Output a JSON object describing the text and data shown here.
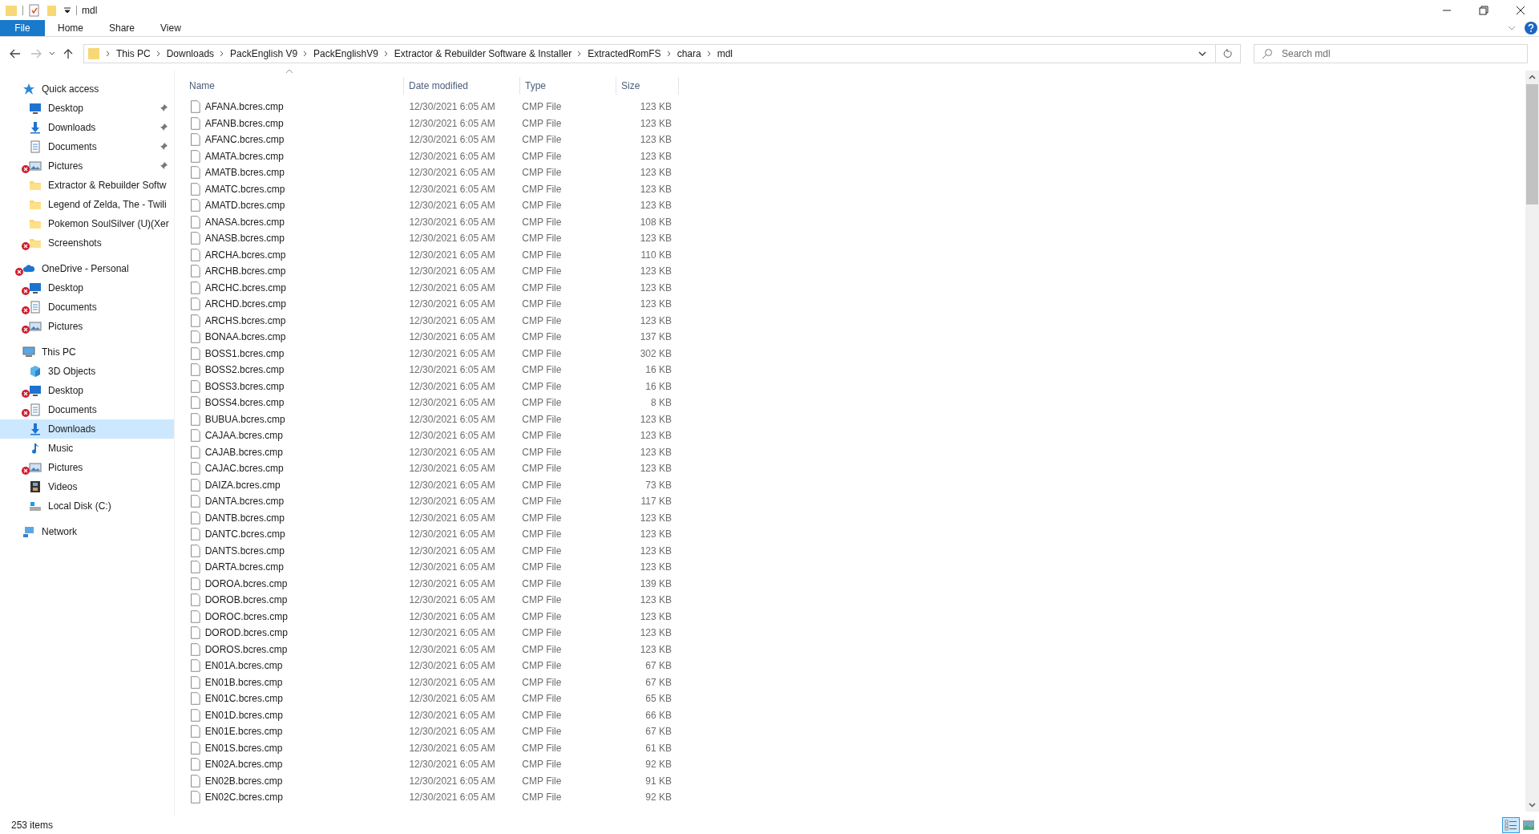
{
  "window": {
    "title": "mdl"
  },
  "ribbon_tabs": [
    {
      "label": "File",
      "selected": true
    },
    {
      "label": "Home",
      "selected": false
    },
    {
      "label": "Share",
      "selected": false
    },
    {
      "label": "View",
      "selected": false
    }
  ],
  "breadcrumb": [
    "This PC",
    "Downloads",
    "PackEnglish V9",
    "PackEnglishV9",
    "Extractor & Rebuilder Software & Installer",
    "ExtractedRomFS",
    "chara",
    "mdl"
  ],
  "search": {
    "placeholder": "Search mdl"
  },
  "sidebar": [
    {
      "label": "Quick access",
      "kind": "star",
      "error": false,
      "pinned": false,
      "selected": false,
      "children": [
        {
          "label": "Desktop",
          "kind": "desktop",
          "error": false,
          "pinned": true,
          "selected": false
        },
        {
          "label": "Downloads",
          "kind": "download",
          "error": false,
          "pinned": true,
          "selected": false
        },
        {
          "label": "Documents",
          "kind": "document",
          "error": false,
          "pinned": true,
          "selected": false
        },
        {
          "label": "Pictures",
          "kind": "picture",
          "error": true,
          "pinned": true,
          "selected": false
        },
        {
          "label": "Extractor & Rebuilder Softw",
          "kind": "folder",
          "error": false,
          "pinned": false,
          "selected": false
        },
        {
          "label": "Legend of Zelda, The - Twili",
          "kind": "folder",
          "error": false,
          "pinned": false,
          "selected": false
        },
        {
          "label": "Pokemon SoulSilver (U)(Xer",
          "kind": "folder",
          "error": false,
          "pinned": false,
          "selected": false
        },
        {
          "label": "Screenshots",
          "kind": "folder",
          "error": true,
          "pinned": false,
          "selected": false
        }
      ]
    },
    {
      "label": "OneDrive - Personal",
      "kind": "cloud",
      "error": true,
      "pinned": false,
      "selected": false,
      "children": [
        {
          "label": "Desktop",
          "kind": "desktop",
          "error": true,
          "pinned": false,
          "selected": false
        },
        {
          "label": "Documents",
          "kind": "document",
          "error": true,
          "pinned": false,
          "selected": false
        },
        {
          "label": "Pictures",
          "kind": "picture",
          "error": true,
          "pinned": false,
          "selected": false
        }
      ]
    },
    {
      "label": "This PC",
      "kind": "pc",
      "error": false,
      "pinned": false,
      "selected": false,
      "children": [
        {
          "label": "3D Objects",
          "kind": "cube",
          "error": false,
          "pinned": false,
          "selected": false
        },
        {
          "label": "Desktop",
          "kind": "desktop",
          "error": true,
          "pinned": false,
          "selected": false
        },
        {
          "label": "Documents",
          "kind": "document",
          "error": true,
          "pinned": false,
          "selected": false
        },
        {
          "label": "Downloads",
          "kind": "download",
          "error": false,
          "pinned": false,
          "selected": true
        },
        {
          "label": "Music",
          "kind": "music",
          "error": false,
          "pinned": false,
          "selected": false
        },
        {
          "label": "Pictures",
          "kind": "picture",
          "error": true,
          "pinned": false,
          "selected": false
        },
        {
          "label": "Videos",
          "kind": "video",
          "error": false,
          "pinned": false,
          "selected": false
        },
        {
          "label": "Local Disk (C:)",
          "kind": "disk",
          "error": false,
          "pinned": false,
          "selected": false
        }
      ]
    },
    {
      "label": "Network",
      "kind": "network",
      "error": false,
      "pinned": false,
      "selected": false
    }
  ],
  "table": {
    "columns": [
      "Name",
      "Date modified",
      "Type",
      "Size"
    ],
    "rows": [
      [
        "AFANA.bcres.cmp",
        "12/30/2021 6:05 AM",
        "CMP File",
        "123 KB"
      ],
      [
        "AFANB.bcres.cmp",
        "12/30/2021 6:05 AM",
        "CMP File",
        "123 KB"
      ],
      [
        "AFANC.bcres.cmp",
        "12/30/2021 6:05 AM",
        "CMP File",
        "123 KB"
      ],
      [
        "AMATA.bcres.cmp",
        "12/30/2021 6:05 AM",
        "CMP File",
        "123 KB"
      ],
      [
        "AMATB.bcres.cmp",
        "12/30/2021 6:05 AM",
        "CMP File",
        "123 KB"
      ],
      [
        "AMATC.bcres.cmp",
        "12/30/2021 6:05 AM",
        "CMP File",
        "123 KB"
      ],
      [
        "AMATD.bcres.cmp",
        "12/30/2021 6:05 AM",
        "CMP File",
        "123 KB"
      ],
      [
        "ANASA.bcres.cmp",
        "12/30/2021 6:05 AM",
        "CMP File",
        "108 KB"
      ],
      [
        "ANASB.bcres.cmp",
        "12/30/2021 6:05 AM",
        "CMP File",
        "123 KB"
      ],
      [
        "ARCHA.bcres.cmp",
        "12/30/2021 6:05 AM",
        "CMP File",
        "110 KB"
      ],
      [
        "ARCHB.bcres.cmp",
        "12/30/2021 6:05 AM",
        "CMP File",
        "123 KB"
      ],
      [
        "ARCHC.bcres.cmp",
        "12/30/2021 6:05 AM",
        "CMP File",
        "123 KB"
      ],
      [
        "ARCHD.bcres.cmp",
        "12/30/2021 6:05 AM",
        "CMP File",
        "123 KB"
      ],
      [
        "ARCHS.bcres.cmp",
        "12/30/2021 6:05 AM",
        "CMP File",
        "123 KB"
      ],
      [
        "BONAA.bcres.cmp",
        "12/30/2021 6:05 AM",
        "CMP File",
        "137 KB"
      ],
      [
        "BOSS1.bcres.cmp",
        "12/30/2021 6:05 AM",
        "CMP File",
        "302 KB"
      ],
      [
        "BOSS2.bcres.cmp",
        "12/30/2021 6:05 AM",
        "CMP File",
        "16 KB"
      ],
      [
        "BOSS3.bcres.cmp",
        "12/30/2021 6:05 AM",
        "CMP File",
        "16 KB"
      ],
      [
        "BOSS4.bcres.cmp",
        "12/30/2021 6:05 AM",
        "CMP File",
        "8 KB"
      ],
      [
        "BUBUA.bcres.cmp",
        "12/30/2021 6:05 AM",
        "CMP File",
        "123 KB"
      ],
      [
        "CAJAA.bcres.cmp",
        "12/30/2021 6:05 AM",
        "CMP File",
        "123 KB"
      ],
      [
        "CAJAB.bcres.cmp",
        "12/30/2021 6:05 AM",
        "CMP File",
        "123 KB"
      ],
      [
        "CAJAC.bcres.cmp",
        "12/30/2021 6:05 AM",
        "CMP File",
        "123 KB"
      ],
      [
        "DAIZA.bcres.cmp",
        "12/30/2021 6:05 AM",
        "CMP File",
        "73 KB"
      ],
      [
        "DANTA.bcres.cmp",
        "12/30/2021 6:05 AM",
        "CMP File",
        "117 KB"
      ],
      [
        "DANTB.bcres.cmp",
        "12/30/2021 6:05 AM",
        "CMP File",
        "123 KB"
      ],
      [
        "DANTC.bcres.cmp",
        "12/30/2021 6:05 AM",
        "CMP File",
        "123 KB"
      ],
      [
        "DANTS.bcres.cmp",
        "12/30/2021 6:05 AM",
        "CMP File",
        "123 KB"
      ],
      [
        "DARTA.bcres.cmp",
        "12/30/2021 6:05 AM",
        "CMP File",
        "123 KB"
      ],
      [
        "DOROA.bcres.cmp",
        "12/30/2021 6:05 AM",
        "CMP File",
        "139 KB"
      ],
      [
        "DOROB.bcres.cmp",
        "12/30/2021 6:05 AM",
        "CMP File",
        "123 KB"
      ],
      [
        "DOROC.bcres.cmp",
        "12/30/2021 6:05 AM",
        "CMP File",
        "123 KB"
      ],
      [
        "DOROD.bcres.cmp",
        "12/30/2021 6:05 AM",
        "CMP File",
        "123 KB"
      ],
      [
        "DOROS.bcres.cmp",
        "12/30/2021 6:05 AM",
        "CMP File",
        "123 KB"
      ],
      [
        "EN01A.bcres.cmp",
        "12/30/2021 6:05 AM",
        "CMP File",
        "67 KB"
      ],
      [
        "EN01B.bcres.cmp",
        "12/30/2021 6:05 AM",
        "CMP File",
        "67 KB"
      ],
      [
        "EN01C.bcres.cmp",
        "12/30/2021 6:05 AM",
        "CMP File",
        "65 KB"
      ],
      [
        "EN01D.bcres.cmp",
        "12/30/2021 6:05 AM",
        "CMP File",
        "66 KB"
      ],
      [
        "EN01E.bcres.cmp",
        "12/30/2021 6:05 AM",
        "CMP File",
        "67 KB"
      ],
      [
        "EN01S.bcres.cmp",
        "12/30/2021 6:05 AM",
        "CMP File",
        "61 KB"
      ],
      [
        "EN02A.bcres.cmp",
        "12/30/2021 6:05 AM",
        "CMP File",
        "92 KB"
      ],
      [
        "EN02B.bcres.cmp",
        "12/30/2021 6:05 AM",
        "CMP File",
        "91 KB"
      ],
      [
        "EN02C.bcres.cmp",
        "12/30/2021 6:05 AM",
        "CMP File",
        "92 KB"
      ]
    ]
  },
  "status_bar": {
    "count": "253 items"
  },
  "views": [
    {
      "selected": true
    },
    {
      "selected": false
    }
  ]
}
